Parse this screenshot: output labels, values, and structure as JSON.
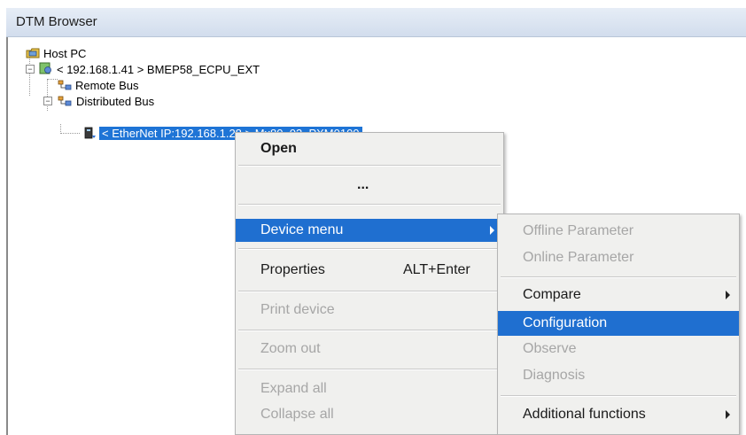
{
  "window": {
    "title": "DTM Browser"
  },
  "tree": {
    "root": "Host PC",
    "cpu": "< 192.168.1.41 > BMEP58_ECPU_EXT",
    "remote_bus": "Remote Bus",
    "distributed_bus": "Distributed Bus",
    "device": "< EtherNet IP:192.168.1.28 > Mx80_03_PXM0100"
  },
  "context_menu": {
    "open": "Open",
    "ellipsis": "...",
    "device_menu": "Device menu",
    "properties": "Properties",
    "properties_shortcut": "ALT+Enter",
    "print_device": "Print device",
    "zoom_out": "Zoom out",
    "expand_all": "Expand all",
    "collapse_all": "Collapse all"
  },
  "submenu": {
    "offline_parameter": "Offline Parameter",
    "online_parameter": "Online Parameter",
    "compare": "Compare",
    "configuration": "Configuration",
    "observe": "Observe",
    "diagnosis": "Diagnosis",
    "additional_functions": "Additional functions"
  },
  "colors": {
    "selection": "#1f6fd0",
    "menu_bg": "#f0f0ee",
    "disabled_text": "#a6a6a6"
  },
  "icons": [
    "host-pc-icon",
    "cpu-icon",
    "bus-icon",
    "device-icon",
    "submenu-arrow-icon",
    "expand-icon"
  ]
}
